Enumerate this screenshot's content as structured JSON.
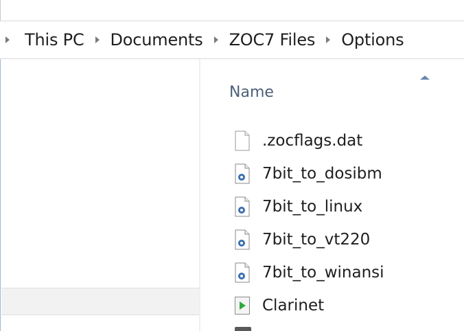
{
  "address_bar": {
    "breadcrumbs": [
      {
        "label": "This PC"
      },
      {
        "label": "Documents"
      },
      {
        "label": "ZOC7 Files"
      },
      {
        "label": "Options"
      }
    ]
  },
  "file_list": {
    "column_header": {
      "name_label": "Name",
      "sort": "ascending"
    },
    "items": [
      {
        "name": ".zocflags.dat",
        "icon": "blank-file-icon"
      },
      {
        "name": "7bit_to_dosibm",
        "icon": "config-file-icon"
      },
      {
        "name": "7bit_to_linux",
        "icon": "config-file-icon"
      },
      {
        "name": "7bit_to_vt220",
        "icon": "config-file-icon"
      },
      {
        "name": "7bit_to_winansi",
        "icon": "config-file-icon"
      },
      {
        "name": "Clarinet",
        "icon": "media-play-file-icon"
      }
    ]
  },
  "colors": {
    "header_text": "#4c607a",
    "sort_arrow": "#6d87ad",
    "play_green": "#2eaa3a",
    "gear_blue": "#3b6fb0"
  }
}
